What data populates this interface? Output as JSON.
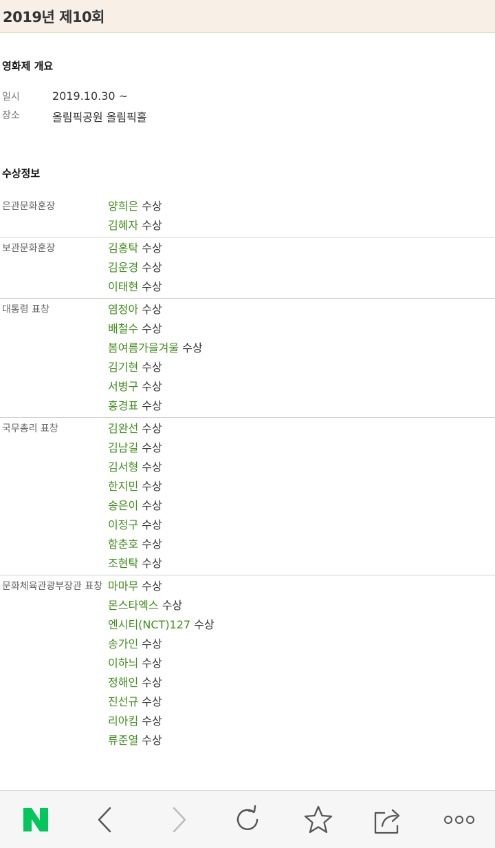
{
  "header": {
    "title": "2019년 제10회"
  },
  "overview": {
    "heading": "영화제 개요",
    "rows": [
      {
        "key": "일시",
        "value": "2019.10.30 ~"
      },
      {
        "key": "장소",
        "value": "올림픽공원 올림픽홀"
      }
    ]
  },
  "awards": {
    "heading": "수상정보",
    "suffix": "수상",
    "groups": [
      {
        "name": "은관문화훈장",
        "recipients": [
          "양희은",
          "김혜자"
        ]
      },
      {
        "name": "보관문화훈장",
        "recipients": [
          "김홍탁",
          "김운경",
          "이태현"
        ]
      },
      {
        "name": "대통령 표창",
        "recipients": [
          "염정아",
          "배철수",
          "봄여름가을겨울",
          "김기현",
          "서병구",
          "홍경표"
        ]
      },
      {
        "name": "국무총리 표창",
        "recipients": [
          "김완선",
          "김남길",
          "김서형",
          "한지민",
          "송은이",
          "이정구",
          "함춘호",
          "조현탁"
        ]
      },
      {
        "name": "문화체육관광부장관 표창",
        "recipients": [
          "마마무",
          "몬스타엑스",
          "엔시티(NCT)127",
          "송가인",
          "이하늬",
          "정해인",
          "진선규",
          "리아킴",
          "류준열"
        ]
      }
    ]
  },
  "toolbar": {
    "buttons": [
      {
        "name": "naver-home-button",
        "icon": "naver-n-icon",
        "label": "N"
      },
      {
        "name": "back-button",
        "icon": "chevron-left-icon"
      },
      {
        "name": "forward-button",
        "icon": "chevron-right-icon"
      },
      {
        "name": "refresh-button",
        "icon": "refresh-icon"
      },
      {
        "name": "bookmark-button",
        "icon": "star-icon"
      },
      {
        "name": "share-button",
        "icon": "share-icon"
      },
      {
        "name": "more-button",
        "icon": "more-dots-icon"
      }
    ],
    "colors": {
      "brand": "#03c75a",
      "icon": "#555555",
      "disabled": "#bbbbbb"
    }
  }
}
